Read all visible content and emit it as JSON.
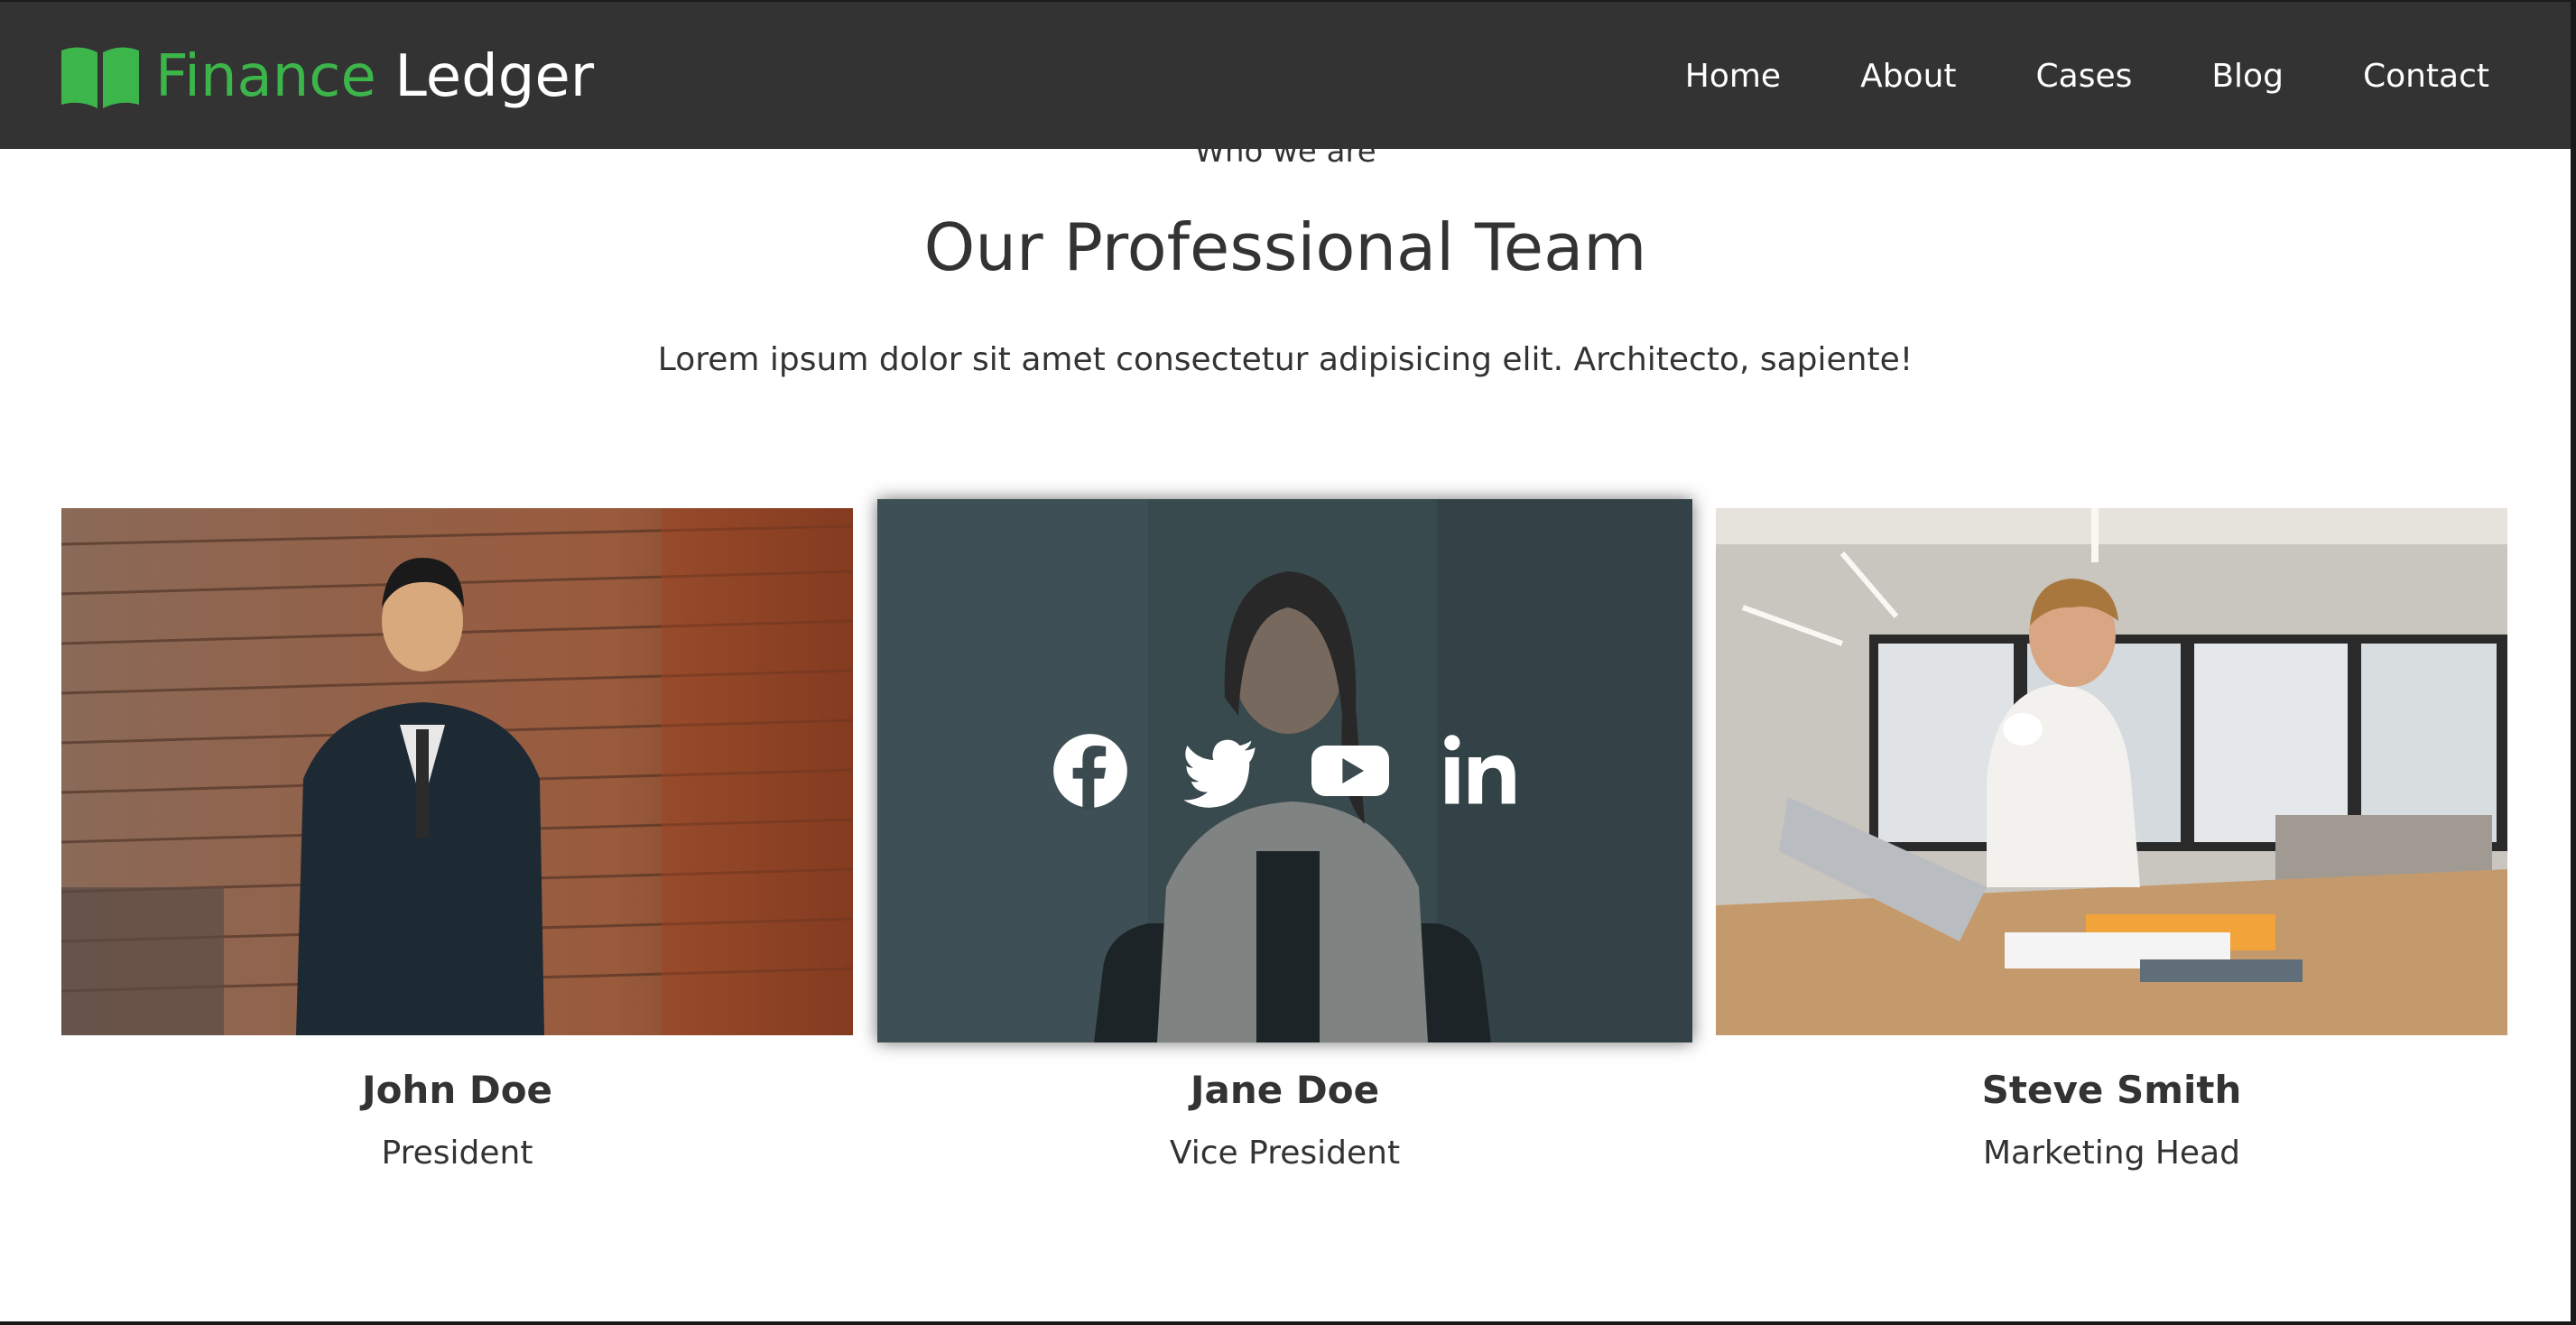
{
  "brand": {
    "part1": "Finance",
    "part2": "Ledger",
    "icon": "open-book-icon"
  },
  "nav": {
    "items": [
      {
        "label": "Home"
      },
      {
        "label": "About"
      },
      {
        "label": "Cases"
      },
      {
        "label": "Blog"
      },
      {
        "label": "Contact"
      }
    ]
  },
  "team_section": {
    "eyebrow": "Who we are",
    "title": "Our Professional Team",
    "description": "Lorem ipsum dolor sit amet consectetur adipisicing elit. Architecto, sapiente!"
  },
  "members": [
    {
      "name": "John Doe",
      "role": "President"
    },
    {
      "name": "Jane Doe",
      "role": "Vice President"
    },
    {
      "name": "Steve Smith",
      "role": "Marketing Head"
    }
  ],
  "social_icons": [
    "facebook-icon",
    "twitter-icon",
    "youtube-icon",
    "linkedin-icon"
  ],
  "colors": {
    "navbar": "#333333",
    "brand_accent": "#3cb54a",
    "text": "#333333",
    "overlay": "#28343a"
  }
}
